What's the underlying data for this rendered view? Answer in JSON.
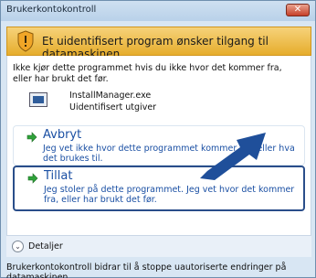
{
  "window": {
    "title": "Brukerkontokontroll",
    "close_label": "✕"
  },
  "header": {
    "headline": "Et uidentifisert program ønsker tilgang til datamaskinen"
  },
  "warning_text": "Ikke kjør dette programmet hvis du ikke hvor det kommer fra, eller har brukt det før.",
  "program": {
    "name": "InstallManager.exe",
    "publisher": "Uidentifisert utgiver"
  },
  "options": {
    "cancel": {
      "label": "Avbryt",
      "description": "Jeg vet ikke hvor dette programmet kommer fra, eller hva det brukes til."
    },
    "allow": {
      "label": "Tillat",
      "description": "Jeg stoler på dette programmet. Jeg vet hvor det kommer fra, eller har brukt det før."
    }
  },
  "details": {
    "label": "Detaljer",
    "icon": "chevron-down-circle-icon"
  },
  "footer_text": "Brukerkontokontroll bidrar til å stoppe uautoriserte endringer på datamaskinen.",
  "colors": {
    "header_band": "#e6ad2c",
    "option_text": "#1a4fa3",
    "highlight_border": "#2a4e8a",
    "arrow": "#1f4f9a"
  }
}
